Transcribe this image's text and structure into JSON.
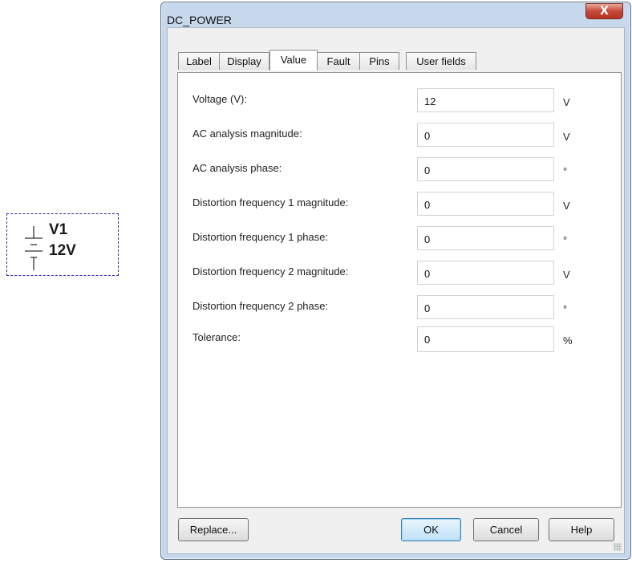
{
  "symbol": {
    "ref": "V1",
    "value": "12V"
  },
  "window": {
    "title": "DC_POWER",
    "close_glyph": "X",
    "tabs": [
      {
        "label": "Label",
        "active": false
      },
      {
        "label": "Display",
        "active": false
      },
      {
        "label": "Value",
        "active": true
      },
      {
        "label": "Fault",
        "active": false
      },
      {
        "label": "Pins",
        "active": false
      },
      {
        "label": "User fields",
        "active": false
      }
    ],
    "fields": [
      {
        "label": "Voltage (V):",
        "value": "12",
        "unit": "V"
      },
      {
        "label": "AC analysis magnitude:",
        "value": "0",
        "unit": "V"
      },
      {
        "label": "AC analysis phase:",
        "value": "0",
        "unit": "°"
      },
      {
        "label": "Distortion frequency 1 magnitude:",
        "value": "0",
        "unit": "V"
      },
      {
        "label": "Distortion frequency 1 phase:",
        "value": "0",
        "unit": "°"
      },
      {
        "label": "Distortion frequency 2 magnitude:",
        "value": "0",
        "unit": "V"
      },
      {
        "label": "Distortion frequency 2 phase:",
        "value": "0",
        "unit": "°"
      },
      {
        "label": "Tolerance:",
        "value": "0",
        "unit": "%"
      }
    ],
    "buttons": {
      "replace": "Replace...",
      "ok": "OK",
      "cancel": "Cancel",
      "help": "Help"
    }
  }
}
